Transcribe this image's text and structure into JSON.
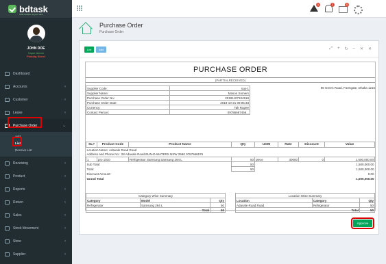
{
  "app": {
    "logo_text": "bdtask",
    "logo_sub": "Total Solution at your door"
  },
  "user": {
    "name": "JOHN DOE",
    "status": "Super Admin",
    "store": "Pinkdlg Street"
  },
  "sidebar": {
    "items": [
      {
        "label": "Dashboard",
        "icon": "home-icon"
      },
      {
        "label": "Accounts",
        "icon": "wallet-icon"
      },
      {
        "label": "Customer",
        "icon": "users-icon"
      },
      {
        "label": "Lease",
        "icon": "tag-icon"
      },
      {
        "label": "Purchase Order",
        "icon": "cart-icon",
        "active": true
      }
    ],
    "submenu": [
      {
        "label": "Add"
      },
      {
        "label": "List",
        "current": true
      },
      {
        "label": "Receive List"
      }
    ],
    "items_after": [
      {
        "label": "Receiving",
        "icon": "truck-icon"
      },
      {
        "label": "Product",
        "icon": "box-icon"
      },
      {
        "label": "Reports",
        "icon": "report-icon"
      },
      {
        "label": "Return",
        "icon": "return-icon"
      },
      {
        "label": "Sales",
        "icon": "sales-icon"
      },
      {
        "label": "Stock Movement",
        "icon": "stock-icon"
      },
      {
        "label": "Store",
        "icon": "store-icon"
      },
      {
        "label": "Supplier",
        "icon": "supplier-icon"
      }
    ]
  },
  "topbar": {
    "warn_count": "1",
    "bell_count": "1",
    "mail_count": "0"
  },
  "header": {
    "title": "Purchase Order",
    "subtitle": "Purchase Order"
  },
  "panel": {
    "list_label": "List",
    "add_label": "Add",
    "actions": [
      "⤢",
      "+",
      "↻",
      "–",
      "✕",
      "✕"
    ]
  },
  "document": {
    "title": "PURCHASE ORDER",
    "status": "(PARTIALRECEIVED)",
    "info": [
      {
        "label": "Supplier Code:",
        "value": "sup-1"
      },
      {
        "label": "Supplier Name:",
        "value": "Mason Somers"
      },
      {
        "label": "Purchase Order No.:",
        "value": "20181107104518"
      },
      {
        "label": "Purchase Order Date:",
        "value": "2018-10-21 09:05:33"
      },
      {
        "label": "Currency:",
        "value": "Tak Rupee"
      },
      {
        "label": "Contact Person:",
        "value": "09786687456..."
      }
    ],
    "supplier_address": "98 Green Road, Farmgate, Dhaka 1215",
    "items_headers": [
      "SL#",
      "Product Code",
      "Product Name",
      "Qty",
      "UOM",
      "Rate",
      "Discount",
      "Value"
    ],
    "location_line": "Location Name: Adavale Road Road",
    "address_line": "Address and Phone No.: 28 Adavale Road BUN-D-WATERS NSW 2590 0757666576",
    "item_row": {
      "sl": "1",
      "code": "pro 1010",
      "name": "Refrigerator Samsung Samsung 294 L",
      "qty": "50",
      "uom": "piece",
      "rate": "30000",
      "discount": "0",
      "value": "1,500,000.00"
    },
    "sub_total_label": "Sub Total:",
    "sub_total_qty": "50",
    "sub_total_value": "1,500,000.00",
    "total_label": "Total:",
    "total_qty": "50",
    "total_value": "1,500,000.00",
    "discount_label": "Discount Amount:",
    "discount_value": "0.00",
    "grand_total_label": "Grand Total",
    "grand_total_value": "1,500,000.00",
    "category_summary": {
      "caption": "Category Wise Summary",
      "headers": [
        "Category",
        "Model",
        "Qty"
      ],
      "row": [
        "Refrigerator",
        "Samsung 294 L",
        "50"
      ],
      "total_label": "Total",
      "total": "50"
    },
    "location_summary": {
      "caption": "Location Wise Summary",
      "headers": [
        "Location",
        "Category",
        "Qty"
      ],
      "row": [
        "Adavale Road Road",
        "Refrigerator",
        "50"
      ],
      "total_label": "Total",
      "total": "50"
    }
  },
  "approve_label": "Approve",
  "colors": {
    "sidebar": "#222d32",
    "accent_green": "#00a65a",
    "highlight_red": "#dd0000"
  }
}
